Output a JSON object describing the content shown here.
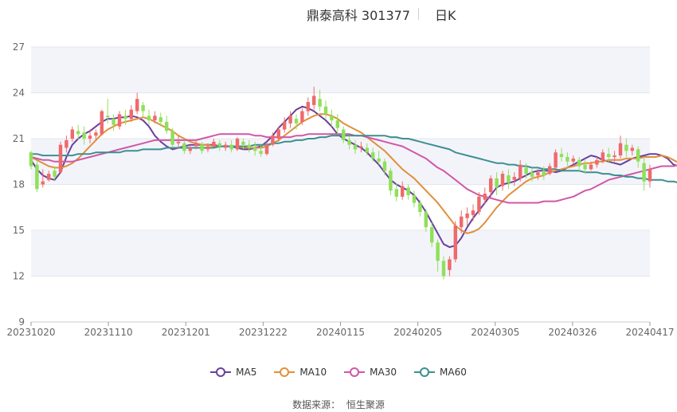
{
  "title": {
    "name": "鼎泰高科 301377",
    "period": "日K"
  },
  "source": {
    "label": "数据来源：",
    "value": "恒生聚源"
  },
  "chart_data": {
    "type": "candlestick",
    "ylim": [
      9,
      27
    ],
    "y_ticks": [
      9,
      12,
      15,
      18,
      21,
      24,
      27
    ],
    "x_ticks": [
      "20231020",
      "20231110",
      "20231201",
      "20231222",
      "20240115",
      "20240205",
      "20240305",
      "20240326",
      "20240417"
    ],
    "grid": "horizontal",
    "legend_position": "bottom-center",
    "colors": {
      "up": "#ef6a6a",
      "down": "#8fe05a",
      "MA5": "#6a3f9e",
      "MA10": "#e0903c",
      "MA30": "#d057a7",
      "MA60": "#3d8f90"
    },
    "candles_ohlc": [
      [
        20.1,
        20.2,
        19.2,
        19.0
      ],
      [
        19.3,
        19.5,
        17.7,
        17.5
      ],
      [
        18.0,
        19.0,
        18.2,
        17.8
      ],
      [
        18.3,
        18.9,
        18.7,
        18.2
      ],
      [
        18.9,
        19.2,
        18.5,
        18.3
      ],
      [
        18.8,
        20.8,
        20.6,
        18.7
      ],
      [
        20.4,
        21.2,
        20.9,
        20.1
      ],
      [
        21.0,
        21.8,
        21.6,
        20.8
      ],
      [
        21.5,
        21.9,
        21.3,
        20.9
      ],
      [
        21.4,
        21.8,
        21.0,
        20.6
      ],
      [
        21.0,
        21.6,
        21.2,
        20.7
      ],
      [
        21.2,
        21.6,
        21.4,
        20.9
      ],
      [
        21.3,
        22.9,
        22.8,
        21.2
      ],
      [
        22.5,
        23.6,
        22.4,
        22.0
      ],
      [
        22.3,
        22.6,
        21.9,
        21.5
      ],
      [
        21.8,
        22.8,
        22.6,
        21.6
      ],
      [
        22.5,
        22.9,
        22.3,
        21.9
      ],
      [
        22.3,
        23.2,
        22.9,
        22.1
      ],
      [
        22.8,
        24.0,
        23.6,
        22.6
      ],
      [
        23.2,
        23.4,
        22.8,
        22.4
      ],
      [
        22.5,
        22.9,
        22.2,
        21.9
      ],
      [
        22.2,
        22.8,
        22.5,
        22.0
      ],
      [
        22.4,
        22.7,
        22.1,
        21.8
      ],
      [
        22.1,
        22.5,
        21.5,
        21.3
      ],
      [
        21.5,
        21.7,
        20.6,
        20.4
      ],
      [
        20.7,
        21.2,
        20.8,
        20.4
      ],
      [
        20.7,
        20.9,
        20.2,
        20.0
      ],
      [
        20.2,
        20.6,
        20.4,
        20.0
      ],
      [
        20.5,
        20.9,
        20.7,
        20.3
      ],
      [
        20.6,
        20.8,
        20.2,
        20.0
      ],
      [
        20.3,
        20.7,
        20.5,
        20.1
      ],
      [
        20.5,
        21.0,
        20.8,
        20.4
      ],
      [
        20.7,
        20.9,
        20.5,
        20.2
      ],
      [
        20.4,
        20.8,
        20.6,
        20.2
      ],
      [
        20.6,
        20.9,
        20.3,
        20.1
      ],
      [
        20.3,
        21.1,
        21.0,
        20.2
      ],
      [
        20.8,
        21.0,
        20.6,
        20.3
      ],
      [
        20.6,
        20.9,
        20.4,
        20.1
      ],
      [
        20.4,
        20.8,
        20.2,
        19.9
      ],
      [
        20.2,
        20.6,
        20.0,
        19.8
      ],
      [
        20.0,
        20.8,
        20.6,
        19.9
      ],
      [
        20.6,
        21.4,
        21.2,
        20.5
      ],
      [
        21.0,
        21.8,
        21.6,
        20.8
      ],
      [
        21.6,
        22.4,
        22.1,
        21.4
      ],
      [
        22.0,
        22.8,
        22.5,
        21.7
      ],
      [
        22.3,
        22.6,
        22.0,
        21.6
      ],
      [
        22.1,
        23.0,
        22.8,
        21.9
      ],
      [
        22.8,
        23.7,
        23.4,
        22.5
      ],
      [
        23.2,
        24.4,
        23.8,
        22.9
      ],
      [
        23.6,
        24.2,
        23.1,
        22.8
      ],
      [
        23.1,
        23.5,
        22.6,
        22.3
      ],
      [
        22.5,
        22.9,
        22.2,
        21.8
      ],
      [
        22.2,
        22.6,
        21.7,
        21.3
      ],
      [
        21.6,
        21.8,
        20.9,
        20.7
      ],
      [
        20.9,
        21.2,
        20.6,
        20.3
      ],
      [
        20.6,
        20.9,
        20.3,
        20.0
      ],
      [
        20.4,
        20.8,
        20.5,
        20.1
      ],
      [
        20.4,
        20.7,
        20.1,
        19.9
      ],
      [
        20.1,
        20.4,
        19.7,
        19.5
      ],
      [
        19.7,
        20.2,
        19.5,
        19.3
      ],
      [
        19.5,
        19.7,
        18.9,
        18.6
      ],
      [
        18.9,
        19.1,
        17.6,
        17.3
      ],
      [
        17.7,
        18.1,
        17.2,
        16.9
      ],
      [
        17.2,
        18.2,
        17.9,
        17.0
      ],
      [
        17.8,
        18.0,
        17.3,
        17.0
      ],
      [
        17.3,
        17.6,
        16.8,
        16.5
      ],
      [
        16.8,
        17.0,
        16.2,
        15.9
      ],
      [
        16.2,
        16.4,
        15.2,
        14.9
      ],
      [
        15.2,
        15.5,
        14.2,
        13.9
      ],
      [
        14.2,
        14.4,
        13.0,
        12.3
      ],
      [
        13.0,
        13.3,
        12.0,
        11.8
      ],
      [
        12.4,
        13.3,
        13.1,
        12.0
      ],
      [
        13.1,
        15.6,
        15.3,
        12.9
      ],
      [
        15.2,
        16.3,
        15.9,
        14.8
      ],
      [
        15.8,
        16.5,
        16.1,
        15.3
      ],
      [
        16.0,
        16.7,
        16.3,
        15.6
      ],
      [
        16.2,
        17.5,
        17.2,
        16.0
      ],
      [
        17.0,
        17.8,
        17.4,
        16.7
      ],
      [
        17.5,
        18.6,
        18.4,
        17.1
      ],
      [
        18.4,
        18.8,
        17.8,
        17.3
      ],
      [
        17.9,
        18.9,
        18.7,
        17.6
      ],
      [
        18.6,
        19.0,
        18.1,
        17.7
      ],
      [
        18.3,
        18.8,
        18.5,
        17.9
      ],
      [
        18.4,
        19.6,
        19.3,
        18.2
      ],
      [
        19.1,
        19.4,
        18.7,
        18.4
      ],
      [
        18.8,
        19.1,
        18.5,
        18.2
      ],
      [
        18.6,
        19.0,
        18.8,
        18.3
      ],
      [
        18.9,
        19.2,
        18.6,
        18.3
      ],
      [
        18.7,
        19.4,
        19.2,
        18.6
      ],
      [
        19.1,
        20.3,
        20.1,
        18.9
      ],
      [
        20.0,
        20.4,
        19.8,
        19.5
      ],
      [
        19.8,
        20.1,
        19.5,
        19.2
      ],
      [
        19.5,
        19.9,
        19.7,
        19.3
      ],
      [
        19.6,
        19.8,
        19.2,
        18.9
      ],
      [
        19.3,
        19.6,
        19.0,
        18.7
      ],
      [
        19.0,
        19.5,
        19.3,
        18.9
      ],
      [
        19.3,
        19.8,
        19.6,
        19.1
      ],
      [
        19.6,
        20.3,
        20.1,
        19.4
      ],
      [
        20.0,
        20.4,
        19.8,
        19.4
      ],
      [
        19.8,
        20.2,
        19.9,
        19.5
      ],
      [
        19.9,
        21.2,
        20.7,
        19.7
      ],
      [
        20.6,
        21.0,
        20.2,
        19.8
      ],
      [
        20.2,
        20.6,
        20.4,
        19.9
      ],
      [
        20.3,
        20.5,
        19.5,
        19.1
      ],
      [
        19.4,
        19.8,
        18.2,
        17.6
      ],
      [
        18.2,
        19.3,
        19.0,
        17.8
      ]
    ],
    "ma": {
      "MA5": [
        19.6,
        19.0,
        18.6,
        18.4,
        18.3,
        18.8,
        19.8,
        20.6,
        21.0,
        21.3,
        21.5,
        21.8,
        22.1,
        22.3,
        22.3,
        22.4,
        22.4,
        22.5,
        22.4,
        22.2,
        21.8,
        21.2,
        20.8,
        20.5,
        20.3,
        20.4,
        20.5,
        20.6,
        20.6,
        20.6,
        20.6,
        20.6,
        20.5,
        20.5,
        20.5,
        20.4,
        20.3,
        20.3,
        20.4,
        20.5,
        20.8,
        21.2,
        21.7,
        22.1,
        22.5,
        22.9,
        23.1,
        23.0,
        22.8,
        22.5,
        22.2,
        21.8,
        21.3,
        21.0,
        20.8,
        20.6,
        20.4,
        20.1,
        19.7,
        19.3,
        18.8,
        18.3,
        18.0,
        17.8,
        17.6,
        17.3,
        16.8,
        16.2,
        15.5,
        14.8,
        14.1,
        13.9,
        14.0,
        14.5,
        15.2,
        15.8,
        16.3,
        16.8,
        17.3,
        17.8,
        18.0,
        18.1,
        18.2,
        18.4,
        18.6,
        18.8,
        18.9,
        18.9,
        18.9,
        18.8,
        18.9,
        19.1,
        19.3,
        19.5,
        19.7,
        19.9,
        19.8,
        19.6,
        19.5,
        19.4,
        19.3,
        19.5,
        19.7,
        19.8,
        19.9,
        20.0,
        20.0,
        19.9,
        19.7,
        19.3,
        19.2
      ],
      "MA10": [
        19.8,
        19.6,
        19.4,
        19.2,
        19.1,
        19.1,
        19.2,
        19.4,
        19.7,
        20.1,
        20.5,
        20.9,
        21.3,
        21.6,
        21.8,
        22.0,
        22.1,
        22.2,
        22.3,
        22.4,
        22.3,
        22.1,
        21.9,
        21.7,
        21.5,
        21.2,
        21.0,
        20.8,
        20.7,
        20.6,
        20.6,
        20.5,
        20.5,
        20.5,
        20.5,
        20.5,
        20.4,
        20.4,
        20.4,
        20.4,
        20.5,
        20.7,
        20.9,
        21.2,
        21.5,
        21.8,
        22.1,
        22.3,
        22.5,
        22.6,
        22.6,
        22.5,
        22.3,
        22.0,
        21.8,
        21.6,
        21.4,
        21.1,
        20.8,
        20.5,
        20.2,
        19.8,
        19.4,
        19.0,
        18.7,
        18.4,
        18.0,
        17.6,
        17.2,
        16.8,
        16.3,
        15.8,
        15.3,
        15.0,
        14.8,
        14.9,
        15.1,
        15.5,
        16.0,
        16.5,
        16.9,
        17.3,
        17.6,
        17.9,
        18.2,
        18.4,
        18.5,
        18.6,
        18.8,
        18.9,
        19.0,
        19.1,
        19.2,
        19.3,
        19.4,
        19.4,
        19.5,
        19.5,
        19.6,
        19.6,
        19.6,
        19.7,
        19.7,
        19.7,
        19.8,
        19.8,
        19.8,
        19.9,
        19.8,
        19.6,
        19.4
      ],
      "MA30": [
        19.8,
        19.7,
        19.6,
        19.6,
        19.5,
        19.5,
        19.5,
        19.5,
        19.6,
        19.7,
        19.8,
        19.9,
        20.0,
        20.1,
        20.2,
        20.3,
        20.4,
        20.5,
        20.6,
        20.7,
        20.8,
        20.9,
        20.9,
        20.9,
        20.9,
        20.9,
        20.9,
        20.9,
        20.9,
        21.0,
        21.1,
        21.2,
        21.3,
        21.3,
        21.3,
        21.3,
        21.3,
        21.3,
        21.2,
        21.2,
        21.1,
        21.1,
        21.1,
        21.1,
        21.1,
        21.2,
        21.2,
        21.3,
        21.3,
        21.3,
        21.3,
        21.3,
        21.3,
        21.3,
        21.3,
        21.2,
        21.2,
        21.1,
        21.0,
        20.9,
        20.8,
        20.7,
        20.6,
        20.5,
        20.3,
        20.1,
        19.9,
        19.7,
        19.4,
        19.1,
        18.9,
        18.6,
        18.3,
        18.0,
        17.7,
        17.5,
        17.3,
        17.2,
        17.1,
        17.0,
        16.9,
        16.8,
        16.8,
        16.8,
        16.8,
        16.8,
        16.8,
        16.9,
        16.9,
        16.9,
        17.0,
        17.1,
        17.2,
        17.4,
        17.6,
        17.7,
        17.9,
        18.1,
        18.3,
        18.4,
        18.5,
        18.6,
        18.7,
        18.8,
        18.9,
        19.0,
        19.1,
        19.2,
        19.2,
        19.2,
        19.3
      ],
      "MA60": [
        20.0,
        20.0,
        19.9,
        19.9,
        19.9,
        19.9,
        19.9,
        19.9,
        20.0,
        20.0,
        20.0,
        20.1,
        20.1,
        20.1,
        20.1,
        20.1,
        20.2,
        20.2,
        20.2,
        20.3,
        20.3,
        20.3,
        20.3,
        20.4,
        20.4,
        20.4,
        20.4,
        20.4,
        20.4,
        20.4,
        20.4,
        20.4,
        20.5,
        20.5,
        20.5,
        20.5,
        20.5,
        20.5,
        20.6,
        20.6,
        20.6,
        20.7,
        20.7,
        20.8,
        20.8,
        20.9,
        20.9,
        21.0,
        21.0,
        21.1,
        21.1,
        21.2,
        21.2,
        21.2,
        21.2,
        21.2,
        21.2,
        21.2,
        21.2,
        21.2,
        21.2,
        21.1,
        21.1,
        21.0,
        21.0,
        20.9,
        20.8,
        20.7,
        20.6,
        20.5,
        20.4,
        20.3,
        20.1,
        20.0,
        19.9,
        19.8,
        19.7,
        19.6,
        19.5,
        19.4,
        19.4,
        19.3,
        19.3,
        19.2,
        19.2,
        19.1,
        19.1,
        19.0,
        19.0,
        19.0,
        18.9,
        18.9,
        18.9,
        18.9,
        18.8,
        18.8,
        18.8,
        18.7,
        18.7,
        18.6,
        18.6,
        18.5,
        18.5,
        18.4,
        18.4,
        18.3,
        18.3,
        18.3,
        18.2,
        18.2,
        18.1
      ]
    },
    "legend": [
      "MA5",
      "MA10",
      "MA30",
      "MA60"
    ]
  }
}
